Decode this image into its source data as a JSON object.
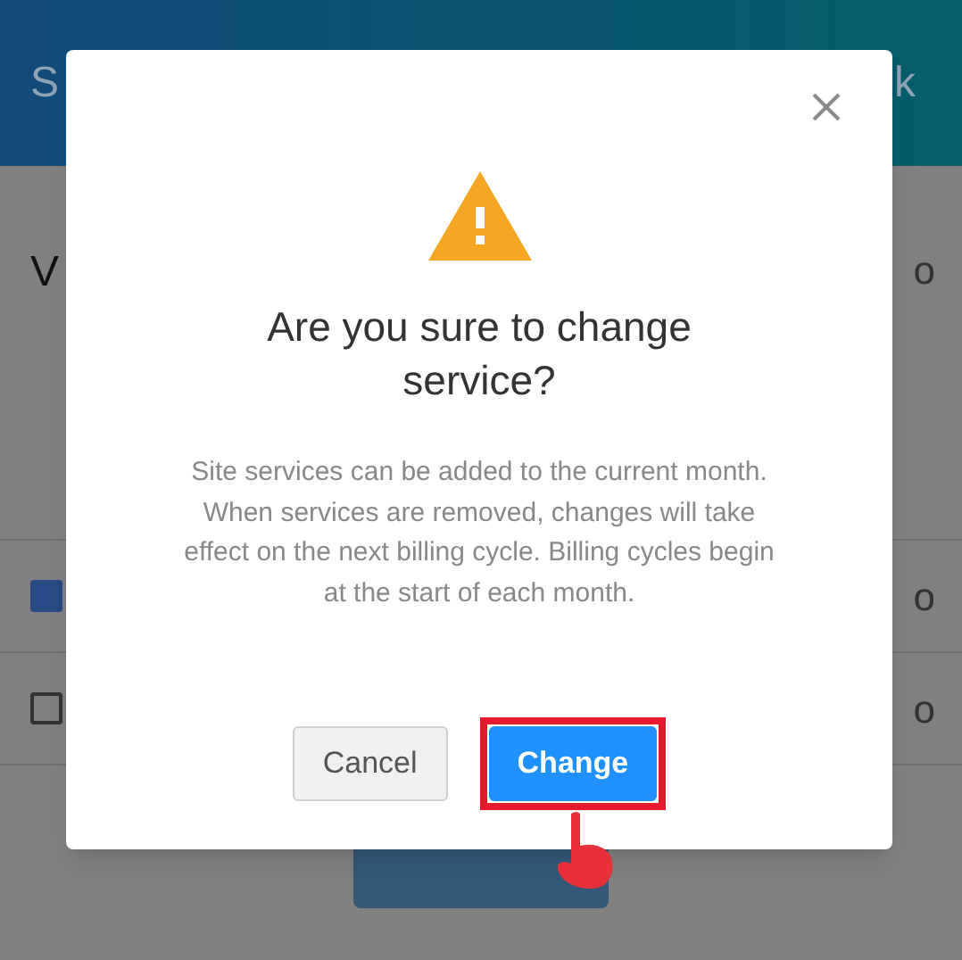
{
  "background": {
    "header_title": "S",
    "header_action": "k",
    "section": {
      "label": "V",
      "value": "o"
    },
    "options": [
      {
        "checked": true,
        "value": "o"
      },
      {
        "checked": false,
        "value": "o"
      }
    ]
  },
  "dialog": {
    "title": "Are you sure to change service?",
    "message": "Site services can be added to the current month. When services are removed, changes will take effect on the next billing cycle. Billing cycles begin at the start of each month.",
    "buttons": [
      {
        "label": "Cancel",
        "kind": "secondary",
        "highlighted": false
      },
      {
        "label": "Change",
        "kind": "primary",
        "highlighted": true
      }
    ]
  }
}
